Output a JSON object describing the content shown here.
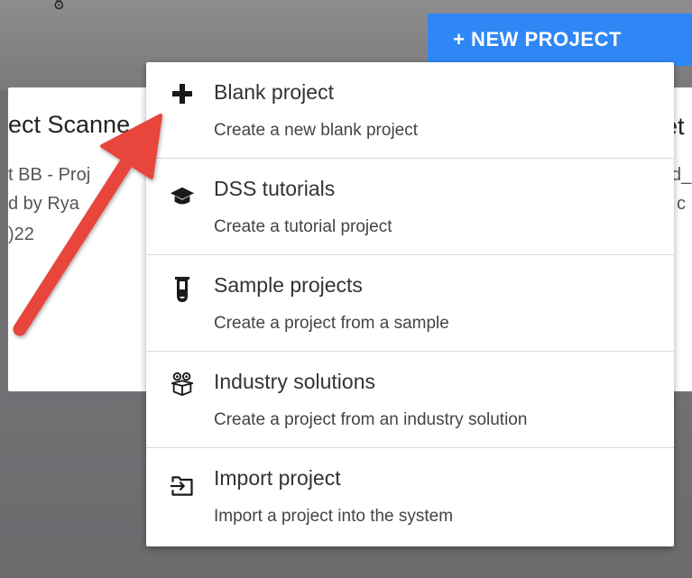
{
  "background": {
    "top_glyph": "ఠ",
    "left_card": {
      "title": "ect Scanne",
      "line1": "t BB - Proj",
      "line2": "d by Rya",
      "line3": ")22"
    },
    "right_card": {
      "title": "et",
      "line1": "d_",
      "line2": "c"
    }
  },
  "new_project_button": {
    "label": "+ NEW PROJECT",
    "color": "#2f87f5"
  },
  "menu": {
    "items": [
      {
        "icon": "plus-icon",
        "title": "Blank project",
        "description": "Create a new blank project"
      },
      {
        "icon": "graduation-cap-icon",
        "title": "DSS tutorials",
        "description": "Create a tutorial project"
      },
      {
        "icon": "test-tube-icon",
        "title": "Sample projects",
        "description": "Create a project from a sample"
      },
      {
        "icon": "gears-box-icon",
        "title": "Industry solutions",
        "description": "Create a project from an industry solution"
      },
      {
        "icon": "import-icon",
        "title": "Import project",
        "description": "Import a project into the system"
      }
    ]
  },
  "annotation": {
    "arrow_color": "#e8453c",
    "arrow_target": "Blank project"
  }
}
